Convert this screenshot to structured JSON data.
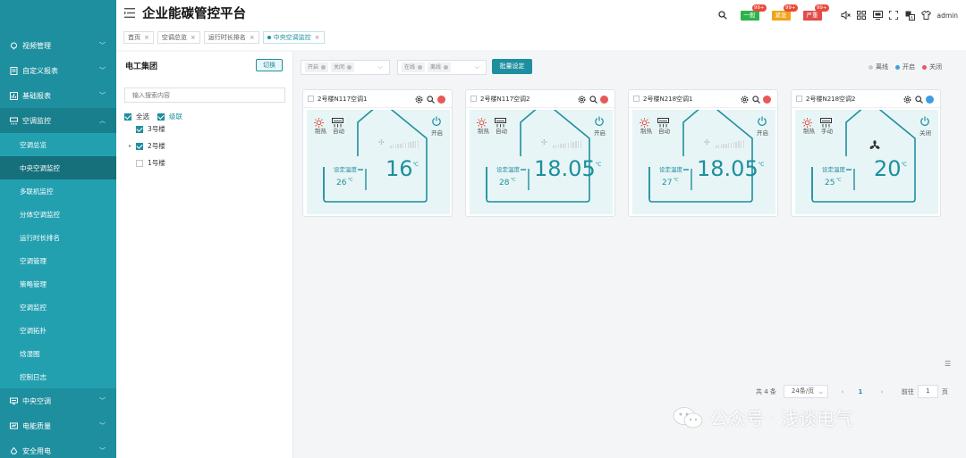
{
  "app": {
    "title": "企业能碳管控平台",
    "user": "admin"
  },
  "header": {
    "alerts": [
      {
        "label": "一般",
        "count": "99+",
        "color": "#2db34a"
      },
      {
        "label": "紧急",
        "count": "99+",
        "color": "#f0a418"
      },
      {
        "label": "严重",
        "count": "99+",
        "color": "#e24b4b"
      }
    ]
  },
  "tabs": [
    {
      "label": "首页",
      "close": "×"
    },
    {
      "label": "空调总览",
      "close": "×"
    },
    {
      "label": "运行时长排名",
      "close": "×"
    },
    {
      "label": "中央空调监控",
      "close": "×"
    }
  ],
  "sidebar": {
    "groups_top": [
      {
        "label": "视频管理",
        "icon": "video-icon"
      },
      {
        "label": "自定义报表",
        "icon": "report-icon"
      },
      {
        "label": "基础报表",
        "icon": "chart-report-icon"
      },
      {
        "label": "空调监控",
        "icon": "ac-icon"
      }
    ],
    "sub_items": [
      "空调总览",
      "中央空调监控",
      "多联机监控",
      "分体空调监控",
      "运行时长排名",
      "空调管理",
      "策略管理",
      "空调监控",
      "空调拓扑",
      "焓湿图",
      "控制日志"
    ],
    "groups_bottom": [
      {
        "label": "中央空调",
        "icon": "central-ac-icon"
      },
      {
        "label": "电能质量",
        "icon": "power-quality-icon"
      },
      {
        "label": "安全用电",
        "icon": "safety-icon"
      }
    ]
  },
  "tree": {
    "org": "电工集团",
    "switch_label": "切换",
    "search_placeholder": "输入搜索内容",
    "select_all": "全选",
    "cascade": "级联",
    "nodes": [
      {
        "label": "3号楼",
        "checked": true
      },
      {
        "label": "2号楼",
        "checked": true,
        "expander": "▸"
      },
      {
        "label": "1号楼",
        "checked": false
      }
    ]
  },
  "filters": {
    "power_chips": [
      "开启",
      "关闭"
    ],
    "online_chips": [
      "在线",
      "离线"
    ],
    "batch_button": "批量设定",
    "legend": [
      {
        "label": "离线",
        "color": "#cccccc"
      },
      {
        "label": "开启",
        "color": "#3a9ee6"
      },
      {
        "label": "关闭",
        "color": "#e95858"
      }
    ]
  },
  "cards": [
    {
      "name": "2号楼N117空调1",
      "mode": "制热",
      "fan_mode": "自动",
      "power": "开启",
      "set_label": "设定温度",
      "set_temp": "26",
      "current_temp": "16",
      "unit": "℃",
      "status_color": "#e95858",
      "show_fan": false
    },
    {
      "name": "2号楼N117空调2",
      "mode": "制热",
      "fan_mode": "自动",
      "power": "开启",
      "set_label": "设定温度",
      "set_temp": "28",
      "current_temp": "18.05",
      "unit": "℃",
      "status_color": "#e95858",
      "show_fan": false
    },
    {
      "name": "2号楼N218空调1",
      "mode": "制热",
      "fan_mode": "自动",
      "power": "开启",
      "set_label": "设定温度",
      "set_temp": "27",
      "current_temp": "18.05",
      "unit": "℃",
      "status_color": "#e95858",
      "show_fan": false
    },
    {
      "name": "2号楼N218空调2",
      "mode": "制热",
      "fan_mode": "手动",
      "power": "关闭",
      "set_label": "设定温度",
      "set_temp": "25",
      "current_temp": "20",
      "unit": "℃",
      "status_color": "#3a9ee6",
      "show_fan": true
    }
  ],
  "pagination": {
    "total": "共 4 条",
    "page_size": "24条/页",
    "current": "1",
    "goto_prefix": "前往",
    "goto_value": "1",
    "goto_suffix": "页"
  },
  "watermark": "公众号 · 浅谈电气"
}
